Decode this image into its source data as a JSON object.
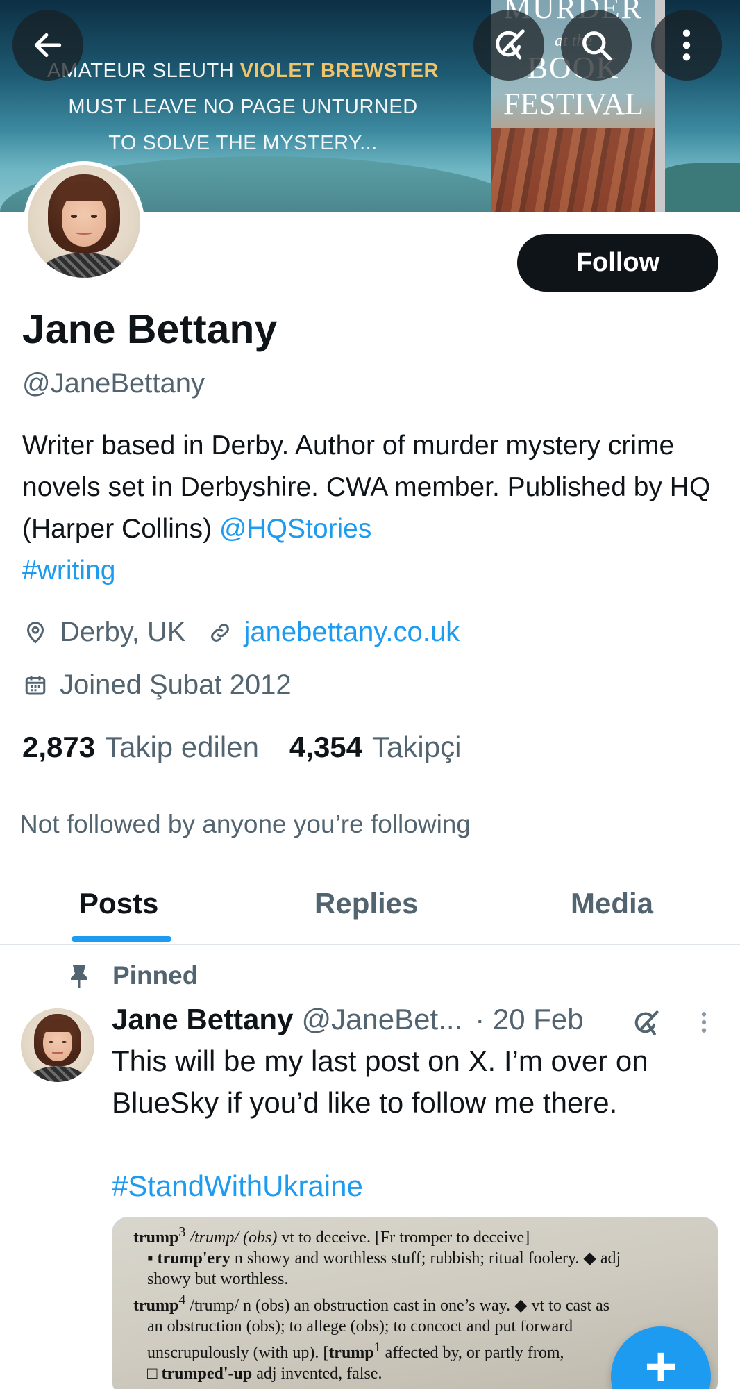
{
  "banner": {
    "tagline_line1_pre": "AMATEUR SLEUTH",
    "tagline_line1_highlight": "VIOLET BREWSTER",
    "tagline_line2": "MUST LEAVE NO PAGE UNTURNED",
    "tagline_line3": "TO SOLVE THE MYSTERY...",
    "book_title_1": "MURDER",
    "book_title_2": "at the",
    "book_title_3": "BOOK",
    "book_title_4": "FESTIVAL"
  },
  "nav": {
    "back_icon": "arrow-left-icon",
    "grok_icon": "grok-icon",
    "search_icon": "search-icon",
    "more_icon": "more-vertical-icon"
  },
  "profile": {
    "follow_label": "Follow",
    "name": "Jane Bettany",
    "handle": "@JaneBettany",
    "bio_text": "Writer based in Derby. Author of murder mystery crime novels set in Derbyshire. CWA member. Published by HQ (Harper Collins) ",
    "bio_mention": "@HQStories",
    "bio_hashtag": "#writing",
    "location": "Derby, UK",
    "website": "janebettany.co.uk",
    "joined": "Joined Şubat 2012",
    "following_count": "2,873",
    "following_label": "Takip edilen",
    "followers_count": "4,354",
    "followers_label": "Takipçi",
    "not_followed": "Not followed by anyone you’re following"
  },
  "tabs": [
    {
      "label": "Posts",
      "active": true
    },
    {
      "label": "Replies",
      "active": false
    },
    {
      "label": "Media",
      "active": false
    }
  ],
  "post": {
    "pinned_label": "Pinned",
    "author_name": "Jane Bettany",
    "author_handle": "@JaneBet...",
    "date": "· 20 Feb",
    "text_line1": "This will be my last post on X. I’m over on BlueSky if you’d like to follow me there.",
    "hashtag": "#StandWithUkraine",
    "image": {
      "l1_word": "trump",
      "l1_sup": "3",
      "l1_pron": " /trump/ (obs) ",
      "l1_rest": "vt to deceive. [Fr tromper to deceive]",
      "l2_word": "▪ trump'ery",
      "l2_rest": " n showy and worthless stuff; rubbish; ritual foolery. ◆ adj",
      "l3": "showy but worthless.",
      "l4_word": "trump",
      "l4_sup": "4",
      "l4_rest": " /trump/ n (obs) an obstruction cast in one’s way. ◆ vt to cast as",
      "l5": "an obstruction (obs); to allege (obs); to concoct and put forward",
      "l6_pre": "unscrupulously (with up). [",
      "l6_word": "trump",
      "l6_sup": "1",
      "l6_rest": " affected by, or partly from,",
      "l7_word": "□ trumped'-up",
      "l7_rest": " adj invented, false."
    }
  },
  "fab": {
    "label": "+"
  },
  "colors": {
    "accent": "#1d9bf0",
    "text_primary": "#0f1419",
    "text_secondary": "#536471",
    "follow_bg": "#0f1419"
  }
}
